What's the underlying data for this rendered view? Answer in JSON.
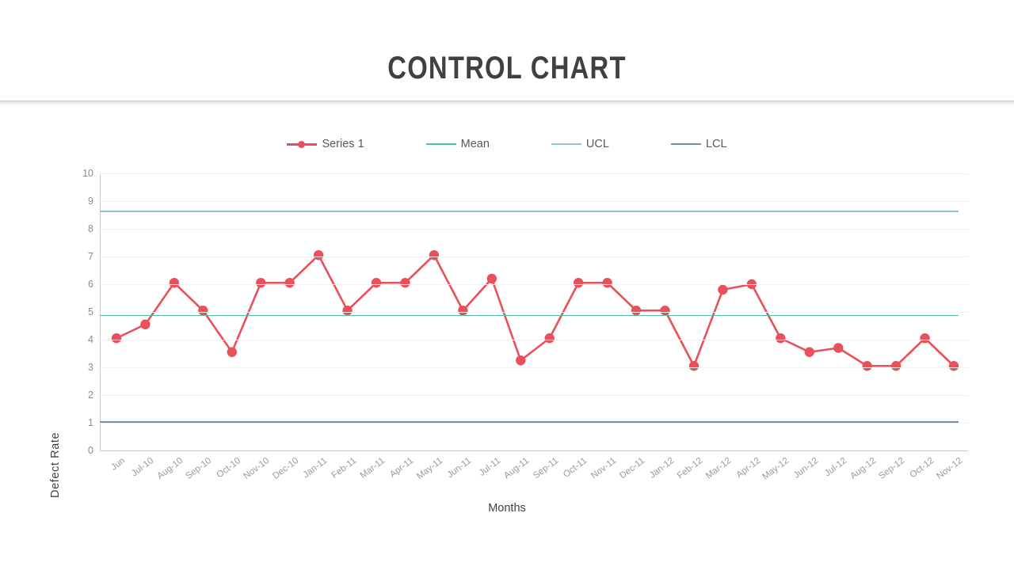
{
  "slide": {
    "title": "CONTROL CHART"
  },
  "legend": {
    "position": "top-center",
    "items": [
      {
        "label": "Series 1",
        "color": "#e8505b",
        "marker": true
      },
      {
        "label": "Mean",
        "color": "#54bfa0",
        "marker": false
      },
      {
        "label": "UCL",
        "color": "#8fc3da",
        "marker": false
      },
      {
        "label": "LCL",
        "color": "#6f8fa8",
        "marker": false
      }
    ]
  },
  "chart_data": {
    "type": "line",
    "title": "CONTROL CHART",
    "xlabel": "Months",
    "ylabel": "Defect  Rate",
    "ylim": [
      0,
      10
    ],
    "yticks": [
      0,
      1,
      2,
      3,
      4,
      5,
      6,
      7,
      8,
      9,
      10
    ],
    "grid": true,
    "categories": [
      "Jun",
      "Jul-10",
      "Aug-10",
      "Sep-10",
      "Oct-10",
      "Nov-10",
      "Dec-10",
      "Jan-11",
      "Feb-11",
      "Mar-11",
      "Apr-11",
      "May-11",
      "Jun-11",
      "Jul-11",
      "Aug-11",
      "Sep-11",
      "Oct-11",
      "Nov-11",
      "Dec-11",
      "Jan-12",
      "Feb-12",
      "Mar-12",
      "Apr-12",
      "May-12",
      "Jun-12",
      "Jul-12",
      "Aug-12",
      "Sep-12",
      "Oct-12",
      "Nov-12"
    ],
    "series": [
      {
        "name": "Series 1",
        "color": "#e8505b",
        "marker": "circle",
        "values": [
          4.05,
          4.55,
          6.05,
          5.05,
          3.55,
          6.05,
          6.05,
          7.05,
          5.05,
          6.05,
          6.05,
          7.05,
          5.05,
          6.2,
          3.25,
          4.05,
          6.05,
          6.05,
          5.05,
          5.05,
          3.05,
          5.8,
          6.0,
          4.05,
          3.55,
          3.7,
          3.05,
          3.05,
          4.05,
          3.05
        ]
      }
    ],
    "reference_lines": [
      {
        "name": "Mean",
        "value": 4.9,
        "color": "#54bfa0"
      },
      {
        "name": "UCL",
        "value": 8.65,
        "color": "#8fc3da"
      },
      {
        "name": "LCL",
        "value": 1.05,
        "color": "#6f8fa8"
      }
    ]
  }
}
